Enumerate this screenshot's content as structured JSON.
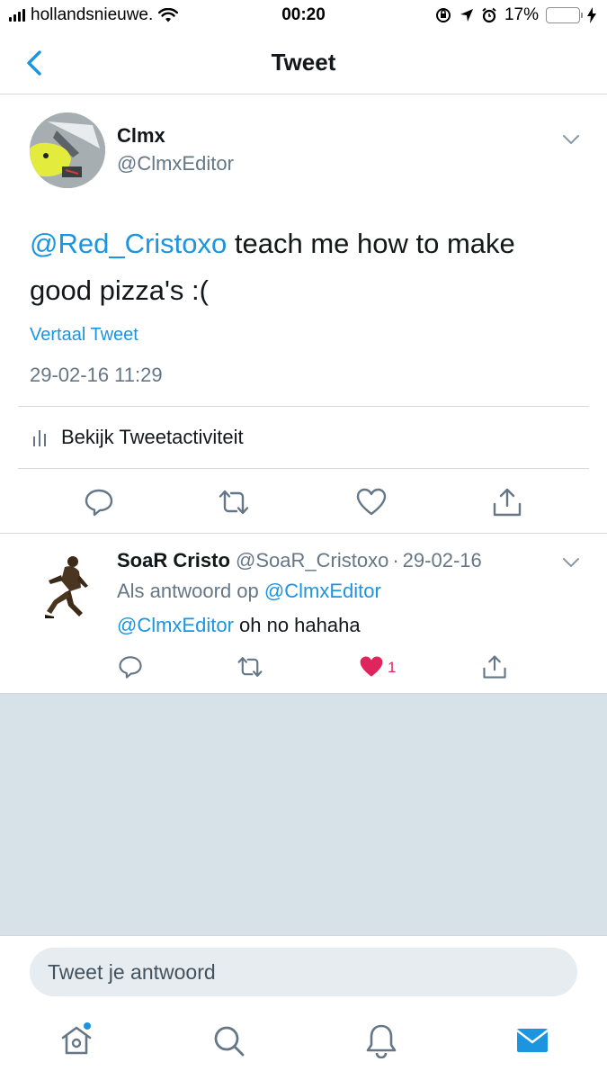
{
  "status_bar": {
    "carrier": "hollandsnieuwe.",
    "time": "00:20",
    "battery_percent": "17%",
    "battery_level": 0.17,
    "battery_color": "#ff3b30"
  },
  "nav": {
    "title": "Tweet",
    "back_icon": "chevron-left-icon"
  },
  "main_tweet": {
    "author_name": "Clmx",
    "author_handle": "@ClmxEditor",
    "mention": "@Red_Cristoxo",
    "text_rest": " teach me how to make good pizza's :(",
    "translate_label": "Vertaal Tweet",
    "timestamp": "29-02-16 11:29",
    "activity_label": "Bekijk Tweetactiviteit",
    "actions": [
      "reply-icon",
      "retweet-icon",
      "like-icon",
      "share-icon"
    ]
  },
  "reply_tweet": {
    "author_name": "SoaR Cristo",
    "author_handle": "@SoaR_Cristoxo",
    "separator": "·",
    "date": "29-02-16",
    "reply_to_prefix": "Als antwoord op",
    "reply_to_handle": "@ClmxEditor",
    "mention": "@ClmxEditor",
    "text_rest": " oh no hahaha",
    "like_count": "1",
    "liked": true
  },
  "compose": {
    "placeholder": "Tweet je antwoord"
  },
  "tab_bar": {
    "tabs": [
      "home-icon",
      "search-icon",
      "notifications-icon",
      "messages-icon"
    ],
    "active": "messages-icon",
    "home_has_dot": true
  },
  "colors": {
    "accent": "#1b95e0",
    "like": "#e0245e",
    "secondary_text": "#657786",
    "empty_background": "#d7e1e8"
  }
}
